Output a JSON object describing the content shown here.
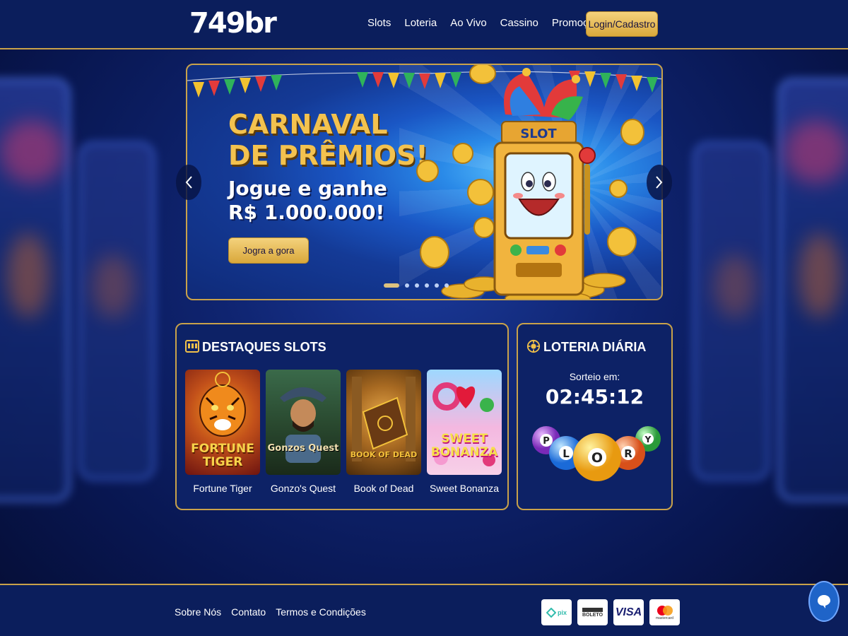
{
  "header": {
    "logo": "749br",
    "nav": [
      "Slots",
      "Loteria",
      "Ao Vivo",
      "Cassino",
      "Promoções"
    ],
    "login_label": "Login/Cadastro"
  },
  "hero": {
    "title_line1": "CARNAVAL",
    "title_line2": "DE PRÊMIOS!",
    "sub_line1": "Jogue e ganhe",
    "sub_line2": "R$ 1.000.000!",
    "cta": "Jogra a gora",
    "slot_label": "SLOT",
    "slides_total": 6,
    "slide_active": 1
  },
  "slots": {
    "title": "DESTAQUES SLOTS",
    "games": [
      {
        "name": "Fortune Tiger",
        "thumb_title": "FORTUNE TIGER"
      },
      {
        "name": "Gonzo's Quest",
        "thumb_title": "Gonzos Quest"
      },
      {
        "name": "Book of Dead",
        "thumb_title": "BOOK OF DEAD"
      },
      {
        "name": "Sweet Bonanza",
        "thumb_title": "SWEET BONANZA"
      }
    ]
  },
  "lottery": {
    "title": "LOTERIA DIÁRIA",
    "draw_label": "Sorteio em:",
    "draw_time": "02:45:12",
    "balls": [
      "P",
      "L",
      "O",
      "R",
      "Y"
    ]
  },
  "footer": {
    "links": [
      "Sobre Nós",
      "Contato",
      "Termos e Condições"
    ],
    "payments": [
      "pix",
      "BOLETO",
      "VISA",
      "mastercard"
    ]
  },
  "icons": {
    "prev": "chevron-left-icon",
    "next": "chevron-right-icon",
    "chat": "chat-icon"
  },
  "colors": {
    "gold": "#c9a24a",
    "navy": "#0d2266",
    "button_gold": "#f4d27d"
  }
}
